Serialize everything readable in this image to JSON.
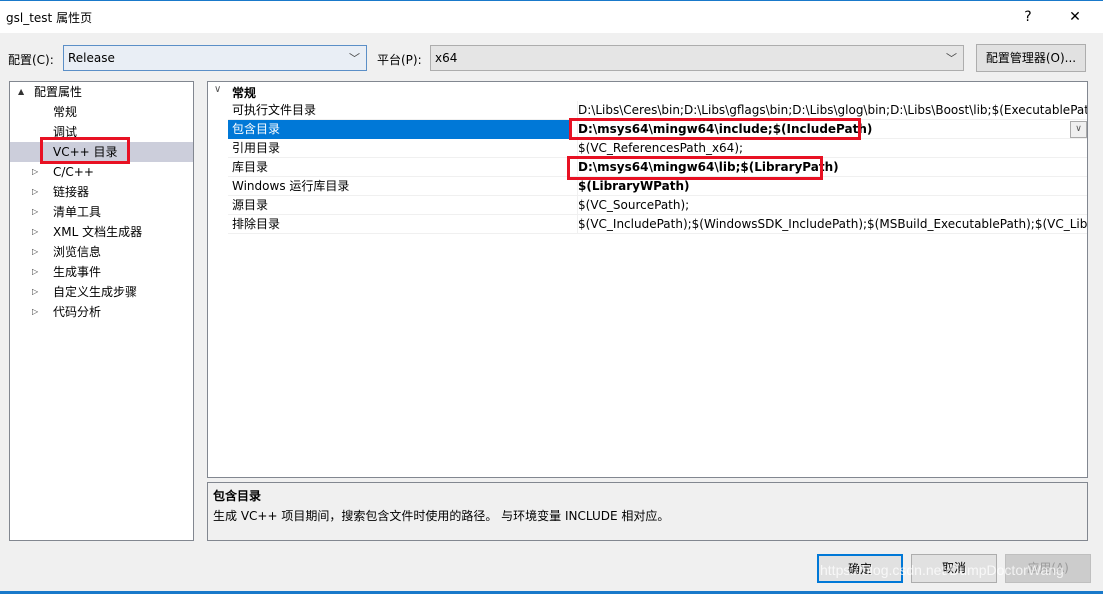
{
  "window": {
    "title": "gsl_test 属性页",
    "help": "?",
    "close": "✕"
  },
  "config": {
    "label": "配置(C):",
    "value": "Release",
    "platform_label": "平台(P):",
    "platform_value": "x64",
    "manager_button": "配置管理器(O)..."
  },
  "tree": {
    "items": [
      {
        "label": "配置属性",
        "expander": "▲",
        "level": 0
      },
      {
        "label": "常规",
        "expander": "",
        "level": 1
      },
      {
        "label": "调试",
        "expander": "",
        "level": 1
      },
      {
        "label": "VC++ 目录",
        "expander": "",
        "level": 1,
        "selected": true
      },
      {
        "label": "C/C++",
        "expander": "▷",
        "level": 1
      },
      {
        "label": "链接器",
        "expander": "▷",
        "level": 1
      },
      {
        "label": "清单工具",
        "expander": "▷",
        "level": 1
      },
      {
        "label": "XML 文档生成器",
        "expander": "▷",
        "level": 1
      },
      {
        "label": "浏览信息",
        "expander": "▷",
        "level": 1
      },
      {
        "label": "生成事件",
        "expander": "▷",
        "level": 1
      },
      {
        "label": "自定义生成步骤",
        "expander": "▷",
        "level": 1
      },
      {
        "label": "代码分析",
        "expander": "▷",
        "level": 1
      }
    ]
  },
  "grid": {
    "category": "常规",
    "rows": [
      {
        "name": "可执行文件目录",
        "value": "D:\\Libs\\Ceres\\bin;D:\\Libs\\gflags\\bin;D:\\Libs\\glog\\bin;D:\\Libs\\Boost\\lib;$(ExecutablePath)",
        "bold": false
      },
      {
        "name": "包含目录",
        "value": "D:\\msys64\\mingw64\\include;$(IncludePath)",
        "bold": true,
        "selected": true,
        "highlighted": true
      },
      {
        "name": "引用目录",
        "value": "$(VC_ReferencesPath_x64);",
        "bold": false
      },
      {
        "name": "库目录",
        "value": "D:\\msys64\\mingw64\\lib;$(LibraryPath)",
        "bold": true,
        "highlighted": true
      },
      {
        "name": "Windows 运行库目录",
        "value": "$(LibraryWPath)",
        "bold": true
      },
      {
        "name": "源目录",
        "value": "$(VC_SourcePath);",
        "bold": false
      },
      {
        "name": "排除目录",
        "value": "$(VC_IncludePath);$(WindowsSDK_IncludePath);$(MSBuild_ExecutablePath);$(VC_LibraryPath)",
        "bold": false
      }
    ]
  },
  "description": {
    "title": "包含目录",
    "text": "生成 VC++ 项目期间，搜索包含文件时使用的路径。 与环境变量 INCLUDE 相对应。"
  },
  "buttons": {
    "ok": "确定",
    "cancel": "取消",
    "apply": "应用(A)"
  },
  "watermark": "https://blog.csdn.net/DumpDoctorWang",
  "colors": {
    "selection": "#0078d7",
    "highlight_box": "#e81123",
    "tree_selection": "#cccedb"
  }
}
